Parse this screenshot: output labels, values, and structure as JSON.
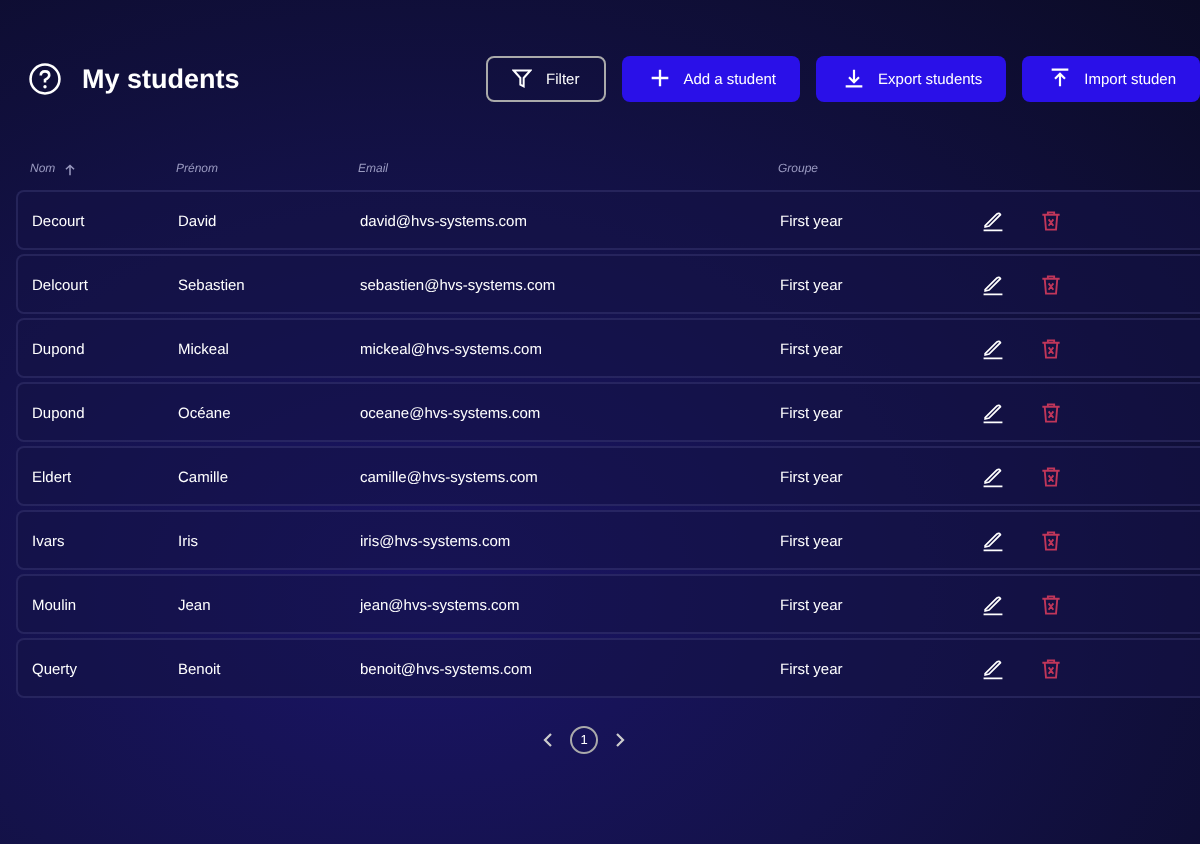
{
  "header": {
    "title": "My students"
  },
  "actions": [
    {
      "kind": "filter",
      "label": "Filter"
    },
    {
      "kind": "add",
      "label": "Add a student"
    },
    {
      "kind": "export",
      "label": "Export students"
    },
    {
      "kind": "import",
      "label": "Import studen"
    }
  ],
  "table": {
    "columns": [
      {
        "label": "Nom",
        "sorted": true
      },
      {
        "label": "Prénom",
        "sorted": false
      },
      {
        "label": "Email",
        "sorted": false
      },
      {
        "label": "Groupe",
        "sorted": false
      }
    ],
    "rows": [
      {
        "nom": "Decourt",
        "prenom": "David",
        "email": "david@hvs-systems.com",
        "groupe": "First year"
      },
      {
        "nom": "Delcourt",
        "prenom": "Sebastien",
        "email": "sebastien@hvs-systems.com",
        "groupe": "First year"
      },
      {
        "nom": "Dupond",
        "prenom": "Mickeal",
        "email": "mickeal@hvs-systems.com",
        "groupe": "First year"
      },
      {
        "nom": "Dupond",
        "prenom": "Océane",
        "email": "oceane@hvs-systems.com",
        "groupe": "First year"
      },
      {
        "nom": "Eldert",
        "prenom": "Camille",
        "email": "camille@hvs-systems.com",
        "groupe": "First year"
      },
      {
        "nom": "Ivars",
        "prenom": "Iris",
        "email": "iris@hvs-systems.com",
        "groupe": "First year"
      },
      {
        "nom": "Moulin",
        "prenom": "Jean",
        "email": "jean@hvs-systems.com",
        "groupe": "First year"
      },
      {
        "nom": "Querty",
        "prenom": "Benoit",
        "email": "benoit@hvs-systems.com",
        "groupe": "First year"
      }
    ]
  },
  "pagination": {
    "pages": [
      {
        "label": "1",
        "selected": true
      }
    ]
  }
}
